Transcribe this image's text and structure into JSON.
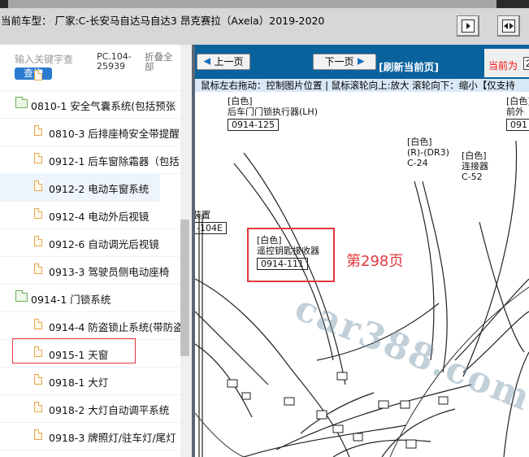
{
  "header": {
    "vehicle_title": "当前车型： 厂家:C-长安马自达马自达3 昂克赛拉（Axela）2019-2020"
  },
  "sidebar": {
    "search_placeholder": "输入关键字查",
    "search_button": "查询",
    "doc_code": "PC.104-25939",
    "collapse_all": "折叠全部",
    "items": [
      {
        "type": "folder",
        "label": "0810-1 安全气囊系统(包括预张"
      },
      {
        "type": "doc",
        "label": "0810-3 后排座椅安全带提醒"
      },
      {
        "type": "doc",
        "label": "0912-1 后车窗除霜器（包括"
      },
      {
        "type": "doc",
        "label": "0912-2 电动车窗系统"
      },
      {
        "type": "doc",
        "label": "0912-4 电动外后视镜"
      },
      {
        "type": "doc",
        "label": "0912-6 自动调光后视镜"
      },
      {
        "type": "doc",
        "label": "0913-3 驾驶员侧电动座椅"
      },
      {
        "type": "folder",
        "label": "0914-1 门锁系统"
      },
      {
        "type": "doc",
        "label": "0914-4 防盗锁止系统(带防盗"
      },
      {
        "type": "doc",
        "label": "0915-1 天窗"
      },
      {
        "type": "doc",
        "label": "0918-1 大灯"
      },
      {
        "type": "doc",
        "label": "0918-2 大灯自动调平系统"
      },
      {
        "type": "doc",
        "label": "0918-3 牌照灯/驻车灯/尾灯"
      }
    ]
  },
  "viewer": {
    "prev_page": "上一页",
    "next_page": "下一页",
    "refresh": "[刷新当前页]",
    "current_page_label": "当前为",
    "current_page_value": "2",
    "hint": "鼠标左右拖动：控制图片位置 | 鼠标滚轮向上:放大  滚轮向下：缩小【仅支持"
  },
  "diagram": {
    "connectors": [
      {
        "color": "[白色]",
        "name": "后车门门锁执行器(LH)",
        "id": "0914-125"
      },
      {
        "color": "[白色]",
        "name": "(R)-(DR3)",
        "id": "C-24"
      },
      {
        "color": "[白色]",
        "name": "连接器",
        "id": "C-52"
      },
      {
        "color": "[白色]",
        "name": "前外",
        "id": "091"
      },
      {
        "color": "",
        "name": "装置",
        "id": "-104E"
      },
      {
        "color": "[白色]",
        "name": "遥控钥匙接收器",
        "id": "0914-111"
      }
    ],
    "page_note": "第298页",
    "watermark": "car388.com"
  }
}
